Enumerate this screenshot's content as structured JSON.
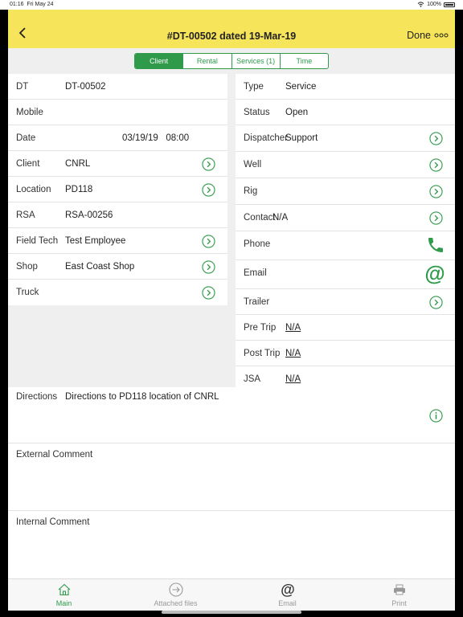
{
  "status_bar": {
    "time": "01:16",
    "date": "Fri May 24",
    "battery": "100%"
  },
  "header": {
    "title": "#DT-00502 dated 19-Mar-19",
    "done_label": "Done"
  },
  "tabs": [
    {
      "label": "Client",
      "active": true
    },
    {
      "label": "Rental",
      "active": false
    },
    {
      "label": "Services (1)",
      "active": false
    },
    {
      "label": "Time",
      "active": false
    }
  ],
  "left_panel": {
    "dt": {
      "label": "DT",
      "value": "DT-00502"
    },
    "mobile": {
      "label": "Mobile",
      "value": ""
    },
    "date": {
      "label": "Date",
      "date": "03/19/19",
      "time": "08:00"
    },
    "client": {
      "label": "Client",
      "value": "CNRL"
    },
    "location": {
      "label": "Location",
      "value": "PD118"
    },
    "rsa": {
      "label": "RSA",
      "value": "RSA-00256"
    },
    "field_tech": {
      "label": "Field Tech",
      "value": "Test Employee"
    },
    "shop": {
      "label": "Shop",
      "value": "East Coast Shop"
    },
    "truck": {
      "label": "Truck",
      "value": ""
    }
  },
  "right_panel": {
    "type": {
      "label": "Type",
      "value": "Service"
    },
    "status": {
      "label": "Status",
      "value": "Open"
    },
    "dispatcher": {
      "label": "Dispatcher",
      "value": "Support"
    },
    "well": {
      "label": "Well",
      "value": ""
    },
    "rig": {
      "label": "Rig",
      "value": ""
    },
    "contact": {
      "label": "Contact",
      "value": "N/A"
    },
    "phone": {
      "label": "Phone"
    },
    "email": {
      "label": "Email"
    },
    "trailer": {
      "label": "Trailer"
    },
    "pre_trip": {
      "label": "Pre Trip",
      "value": "N/A"
    },
    "post_trip": {
      "label": "Post Trip",
      "value": "N/A"
    },
    "jsa": {
      "label": "JSA",
      "value": "N/A"
    }
  },
  "directions": {
    "label": "Directions",
    "value": "Directions to PD118 location of CNRL"
  },
  "external_comment": {
    "label": "External Comment"
  },
  "internal_comment": {
    "label": "Internal Comment"
  },
  "bottom_tabs": [
    {
      "label": "Main",
      "icon": "home-icon",
      "active": true
    },
    {
      "label": "Attached files",
      "icon": "arrow-circle-icon",
      "active": false
    },
    {
      "label": "Email",
      "icon": "at-icon",
      "active": false
    },
    {
      "label": "Print",
      "icon": "printer-icon",
      "active": false
    }
  ],
  "colors": {
    "header_bg": "#f6e45a",
    "accent_green": "#2e9a4a",
    "background": "#efefef"
  }
}
